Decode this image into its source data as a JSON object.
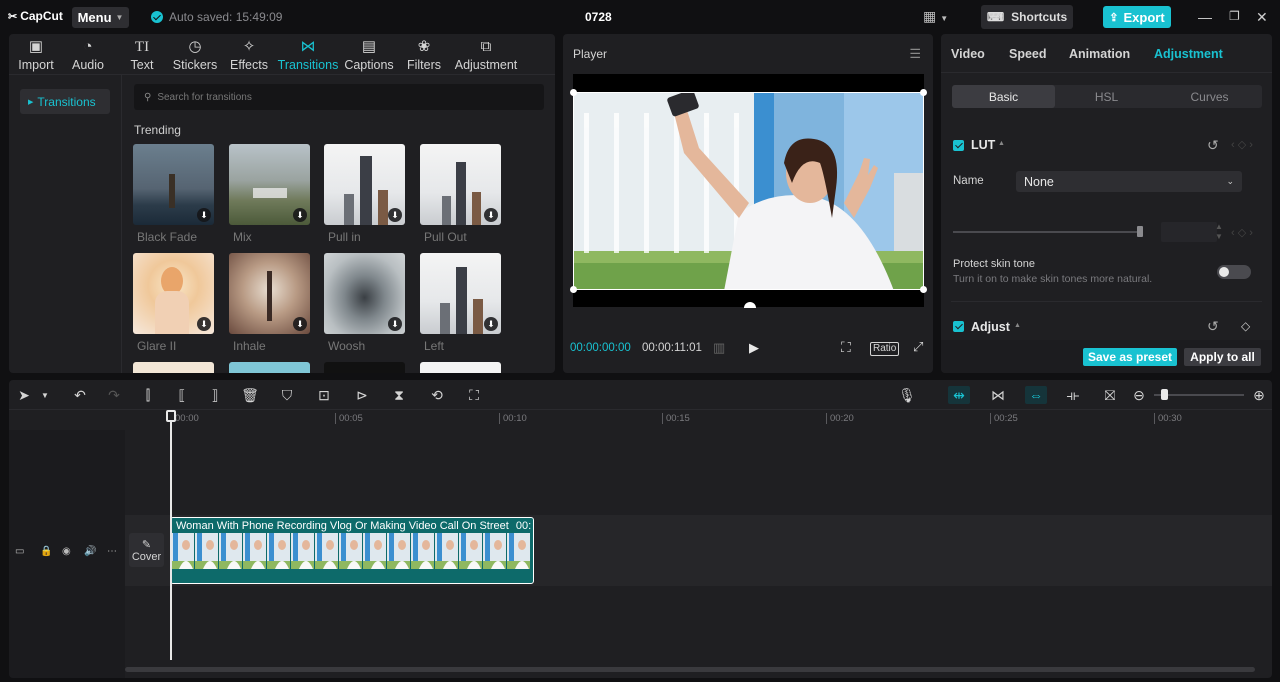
{
  "app": {
    "logo_text": "CapCut",
    "menu_label": "Menu",
    "autosave_text": "Auto saved: 15:49:09",
    "project_title": "0728",
    "shortcuts_label": "Shortcuts",
    "export_label": "Export",
    "accent_color": "#19c2d1"
  },
  "media_tabs": [
    {
      "label": "Import",
      "icon": "import-icon",
      "glyph": "▣"
    },
    {
      "label": "Audio",
      "icon": "audio-icon",
      "glyph": "◔"
    },
    {
      "label": "Text",
      "icon": "text-icon",
      "glyph": "TI"
    },
    {
      "label": "Stickers",
      "icon": "sticker-icon",
      "glyph": "◷"
    },
    {
      "label": "Effects",
      "icon": "effects-icon",
      "glyph": "✧"
    },
    {
      "label": "Transitions",
      "icon": "transitions-icon",
      "glyph": "⋈"
    },
    {
      "label": "Captions",
      "icon": "captions-icon",
      "glyph": "▤"
    },
    {
      "label": "Filters",
      "icon": "filters-icon",
      "glyph": "❀"
    },
    {
      "label": "Adjustment",
      "icon": "adjustment-icon",
      "glyph": "⧉"
    }
  ],
  "active_media_tab": "Transitions",
  "sidebar": {
    "category": "Transitions"
  },
  "search": {
    "placeholder": "Search for transitions"
  },
  "section_title": "Trending",
  "transitions": [
    {
      "label": "Black Fade"
    },
    {
      "label": "Mix"
    },
    {
      "label": "Pull in"
    },
    {
      "label": "Pull Out"
    },
    {
      "label": "Glare II"
    },
    {
      "label": "Inhale"
    },
    {
      "label": "Woosh"
    },
    {
      "label": "Left"
    }
  ],
  "player": {
    "title": "Player",
    "current_time": "00:00:00:00",
    "total_time": "00:00:11:01",
    "ratio_label": "Ratio"
  },
  "inspector": {
    "tabs": [
      "Video",
      "Speed",
      "Animation",
      "Adjustment"
    ],
    "active_tab": "Adjustment",
    "subtabs": [
      "Basic",
      "HSL",
      "Curves"
    ],
    "active_subtab": "Basic",
    "lut_label": "LUT",
    "name_label": "Name",
    "name_value": "None",
    "protect_title": "Protect skin tone",
    "protect_desc": "Turn it on to make skin tones more natural.",
    "adjust_label": "Adjust",
    "save_preset_label": "Save as preset",
    "apply_all_label": "Apply to all"
  },
  "timeline": {
    "ruler_ticks": [
      "00:00",
      "00:05",
      "00:10",
      "00:15",
      "00:20",
      "00:25",
      "00:30"
    ],
    "clip_title": "Woman With Phone Recording Vlog Or Making Video Call On Street",
    "clip_duration_fragment": "00:",
    "cover_label": "Cover"
  }
}
